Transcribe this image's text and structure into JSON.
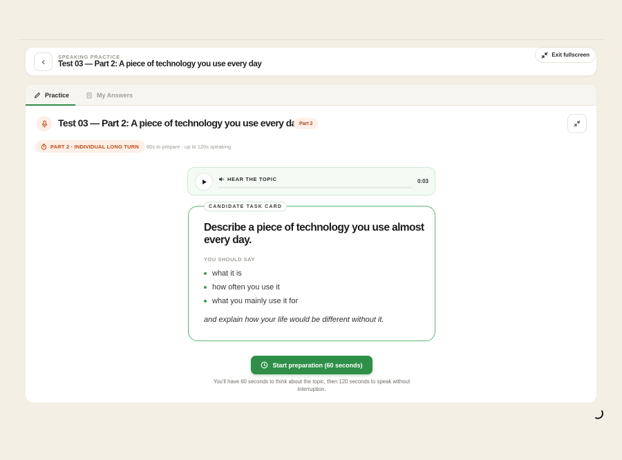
{
  "header": {
    "eyebrow": "SPEAKING PRACTICE",
    "title": "Test 03 — Part 2: A piece of technology you use every day",
    "exit_label": "Exit fullscreen"
  },
  "tabs": [
    {
      "label": "Practice",
      "active": true
    },
    {
      "label": "My Answers",
      "active": false
    }
  ],
  "task": {
    "title": "Test 03 — Part 2: A piece of technology you use every day",
    "badge": "Part 2",
    "turn_label": "PART 2 · INDIVIDUAL LONG TURN",
    "timing_note": "60s to prepare · up to 120s speaking"
  },
  "audio": {
    "label": "HEAR THE TOPIC",
    "time": "0:03"
  },
  "card": {
    "label": "CANDIDATE TASK CARD",
    "prompt": "Describe a piece of technology you use almost every day.",
    "should_say_label": "YOU SHOULD SAY",
    "points": [
      "what it is",
      "how often you use it",
      "what you mainly use it for"
    ],
    "closing": "and explain how your life would be different without it."
  },
  "actions": {
    "start_label": "Start preparation (60 seconds)",
    "helper": "You'll have 60 seconds to think about the topic, then 120 seconds to speak without interruption."
  },
  "colors": {
    "accent_green": "#2f8f49",
    "badge_orange": "#bd4a15",
    "background": "#f3efe5"
  },
  "icons": {
    "back": "chevron-left-icon",
    "exit": "collapse-icon",
    "practice_tab": "pencil-icon",
    "answers_tab": "clipboard-icon",
    "mic": "microphone-icon",
    "timer": "timer-icon",
    "play": "play-icon",
    "speaker": "speaker-icon",
    "start": "clock-icon"
  }
}
